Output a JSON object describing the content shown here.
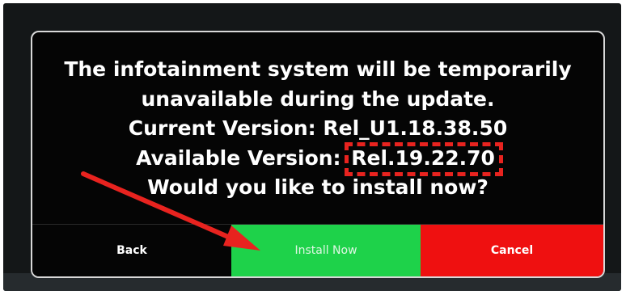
{
  "dialog": {
    "message_lines": [
      "The infotainment system will be temporarily",
      "unavailable during the update.",
      "Current Version: Rel_U1.18.38.50"
    ],
    "available_label": "Available Version:",
    "available_version": "Rel.19.22.70",
    "question": "Would you like to install now?"
  },
  "buttons": {
    "back": "Back",
    "install_now": "Install Now",
    "cancel": "Cancel"
  },
  "colors": {
    "install_button": "#1ed24a",
    "cancel_button": "#ef1010",
    "annotation": "#e8231f"
  }
}
